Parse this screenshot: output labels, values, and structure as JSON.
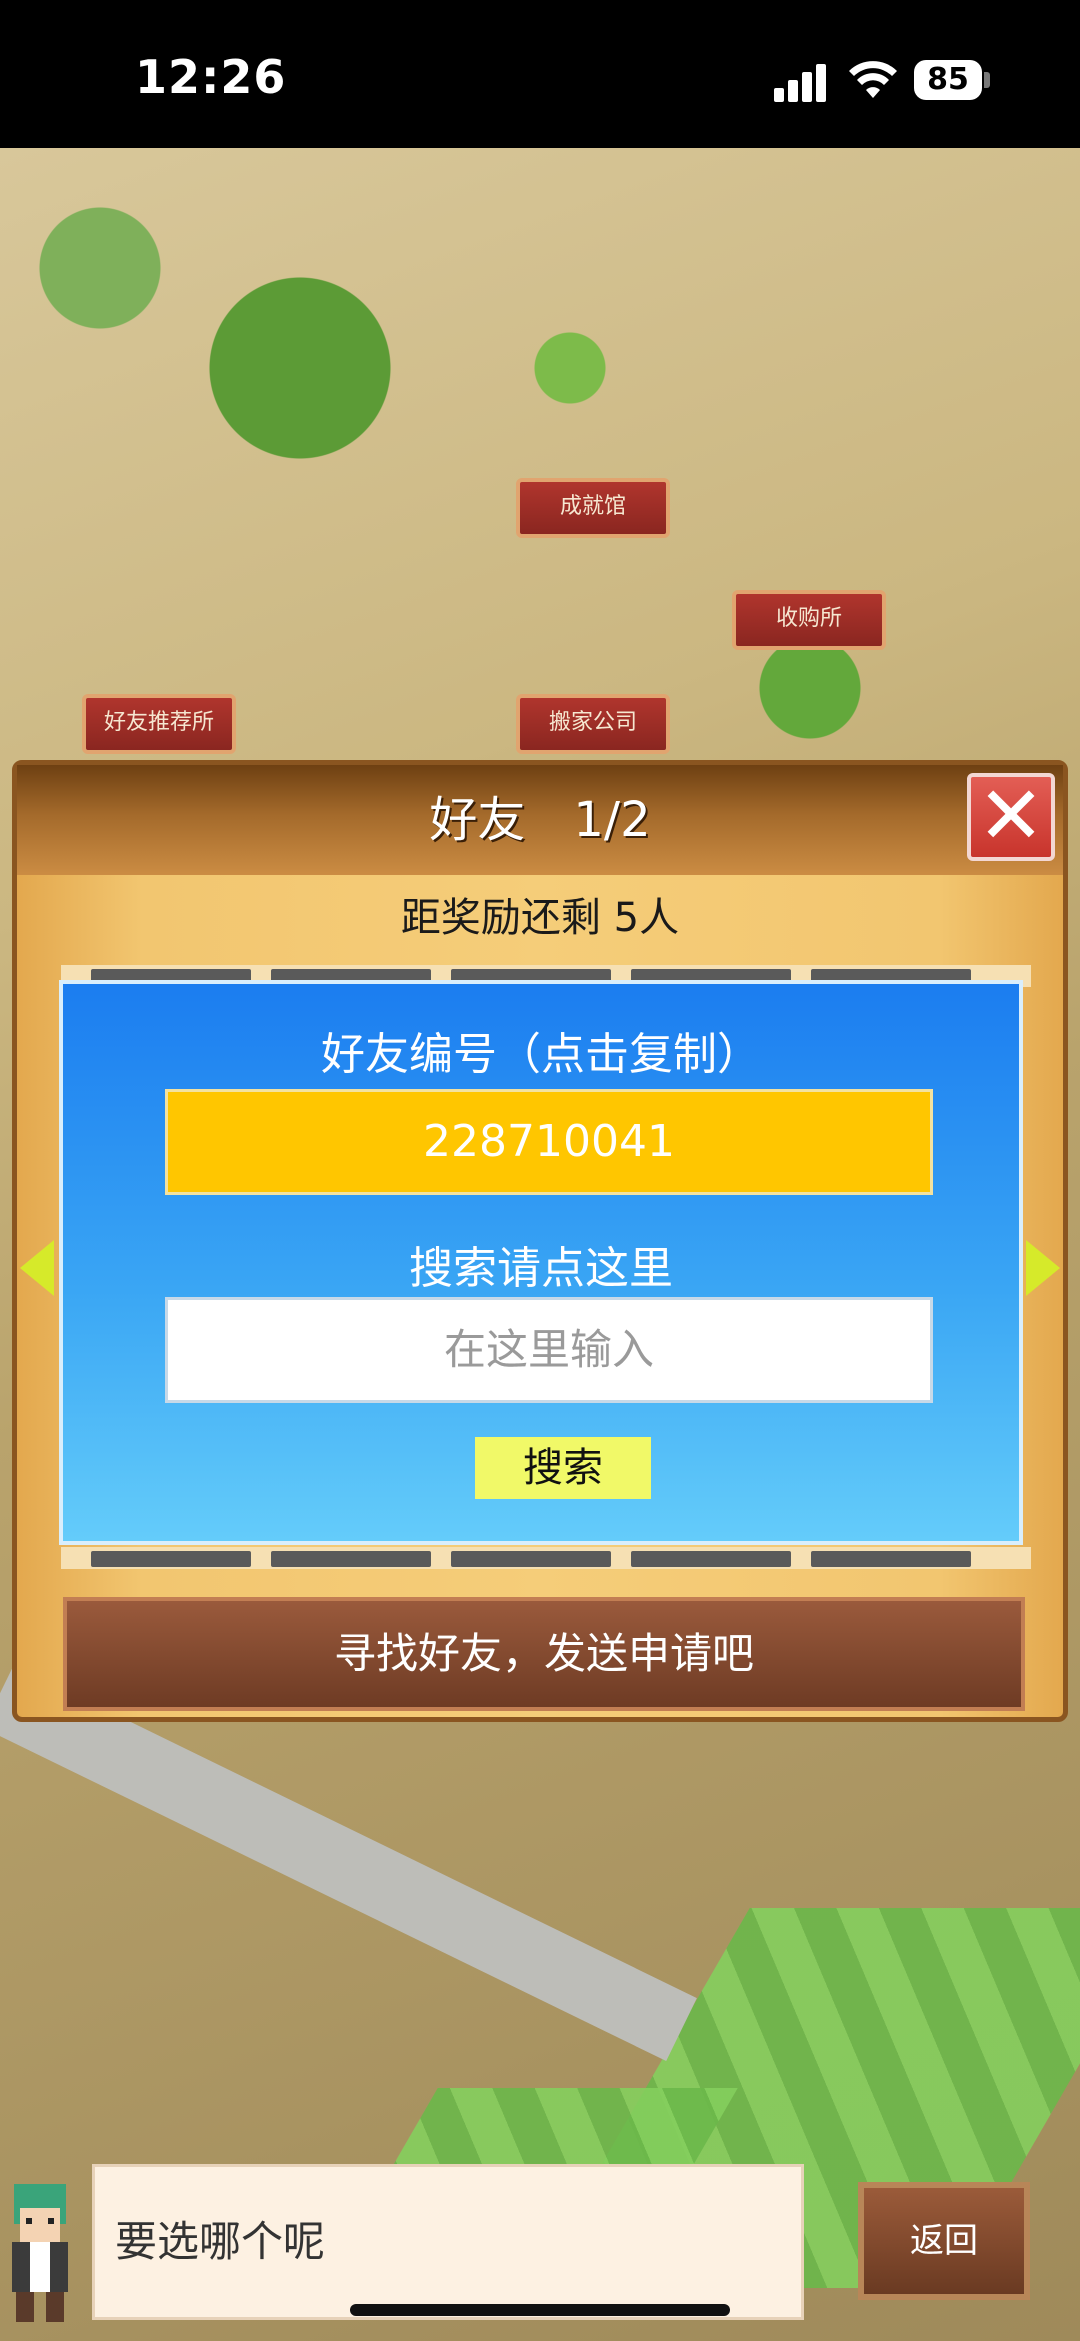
{
  "status_bar": {
    "time": "12:26",
    "battery": "85"
  },
  "map_signs": {
    "achievement_hall": "成就馆",
    "purchase_office": "收购所",
    "friend_recommend": "好友推荐所",
    "moving_company": "搬家公司"
  },
  "dialog": {
    "title": "好友　1/2",
    "close_icon": "close-icon",
    "reward_text": "距奖励还剩 5人",
    "friend_id_label": "好友编号（点击复制）",
    "friend_id": "228710041",
    "search_label": "搜索请点这里",
    "search_placeholder": "在这里输入",
    "search_button": "搜索",
    "find_button": "寻找好友，发送申请吧"
  },
  "bottom_bar": {
    "message": "要选哪个呢",
    "back_button": "返回"
  },
  "colors": {
    "panel_blue": "#1b7df0",
    "id_yellow": "#ffc600",
    "close_red": "#c8342c",
    "title_brown": "#a46a2b"
  }
}
